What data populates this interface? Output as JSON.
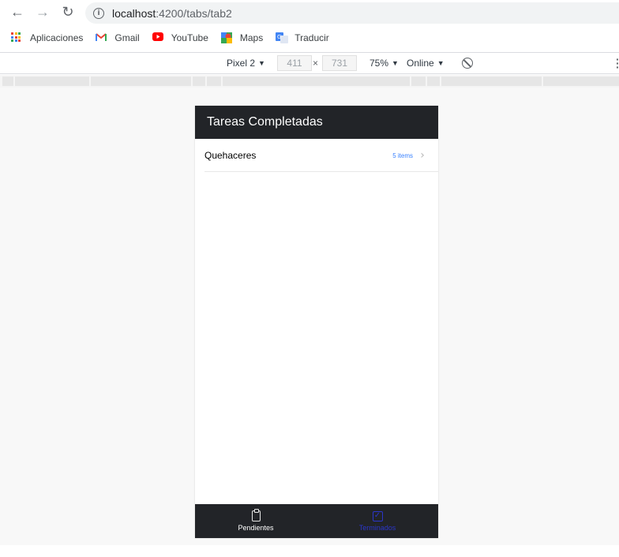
{
  "browser": {
    "back_icon": "arrow-left-icon",
    "forward_icon": "arrow-right-icon",
    "reload_icon": "reload-icon",
    "url_host": "localhost",
    "url_path": ":4200/tabs/tab2"
  },
  "bookmarks": [
    {
      "label": "Aplicaciones",
      "icon": "apps-grid-icon"
    },
    {
      "label": "Gmail",
      "icon": "gmail-icon"
    },
    {
      "label": "YouTube",
      "icon": "youtube-icon"
    },
    {
      "label": "Maps",
      "icon": "maps-icon"
    },
    {
      "label": "Traducir",
      "icon": "translate-icon"
    }
  ],
  "devtools": {
    "device": "Pixel 2",
    "width": "411",
    "times": "×",
    "height": "731",
    "zoom": "75%",
    "network": "Online"
  },
  "app": {
    "title": "Tareas Completadas",
    "list": [
      {
        "label": "Quehaceres",
        "note": "5 items"
      }
    ],
    "tabs": [
      {
        "label": "Pendientes",
        "icon": "clipboard-icon",
        "selected": false
      },
      {
        "label": "Terminados",
        "icon": "checkbox-icon",
        "selected": true
      }
    ]
  },
  "colors": {
    "toolbar_dark": "#222428",
    "accent": "#2b36c9",
    "note_blue": "#3880ff"
  }
}
